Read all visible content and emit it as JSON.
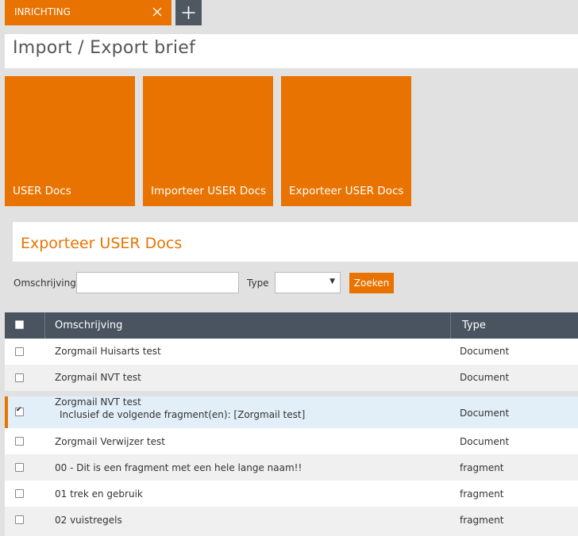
{
  "tabs": [
    {
      "label": "INRICHTING"
    }
  ],
  "page": {
    "title": "Import / Export brief"
  },
  "tiles": [
    {
      "label": "USER Docs"
    },
    {
      "label": "Importeer USER Docs"
    },
    {
      "label": "Exporteer USER Docs"
    }
  ],
  "section": {
    "title": "Exporteer USER Docs"
  },
  "filters": {
    "omschrijving_label": "Omschrijving",
    "omschrijving_value": "",
    "type_label": "Type",
    "type_value": "",
    "search_label": "Zoeken"
  },
  "table": {
    "headers": {
      "omschrijving": "Omschrijving",
      "type": "Type"
    },
    "rows": [
      {
        "omschrijving": "Zorgmail Huisarts test",
        "detail": "",
        "type": "Document",
        "checked": false
      },
      {
        "omschrijving": "Zorgmail NVT test",
        "detail": "",
        "type": "Document",
        "checked": false
      },
      {
        "omschrijving": "Zorgmail NVT test",
        "detail": "Inclusief de volgende fragment(en): [Zorgmail test]",
        "type": "Document",
        "checked": true
      },
      {
        "omschrijving": "Zorgmail Verwijzer test",
        "detail": "",
        "type": "Document",
        "checked": false
      },
      {
        "omschrijving": "00 - Dit is een fragment met een hele lange naam!!",
        "detail": "",
        "type": "fragment",
        "checked": false
      },
      {
        "omschrijving": "01 trek en gebruik",
        "detail": "",
        "type": "fragment",
        "checked": false
      },
      {
        "omschrijving": "02 vuistregels",
        "detail": "",
        "type": "fragment",
        "checked": false
      }
    ]
  },
  "colors": {
    "accent": "#e87300",
    "header_bg": "#4a5460",
    "selected_row": "#e2eef8"
  }
}
